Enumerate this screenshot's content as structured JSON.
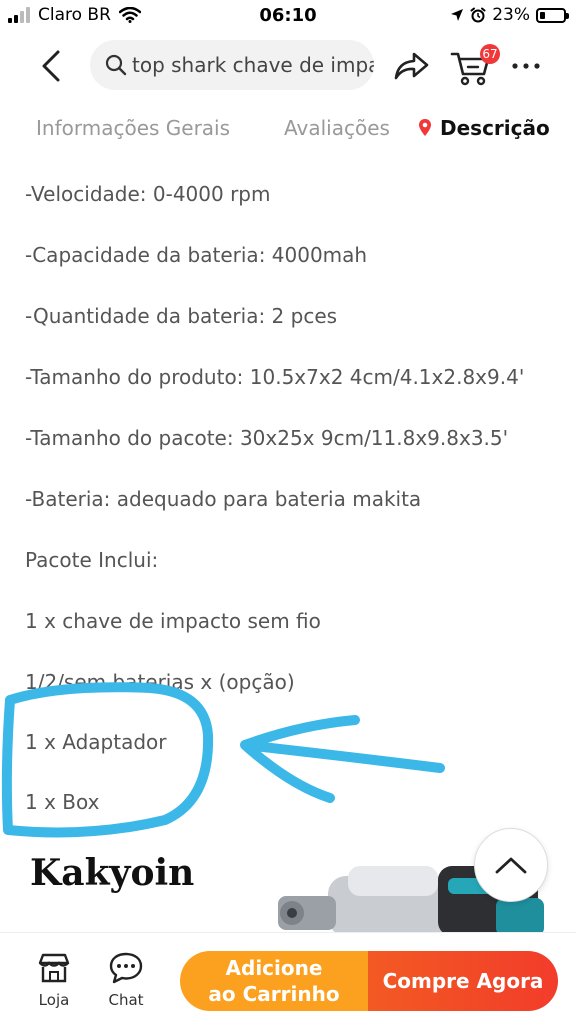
{
  "status_bar": {
    "carrier": "Claro BR",
    "time": "06:10",
    "battery_percent": "23%",
    "battery_level": 0.23
  },
  "header": {
    "search_text": "top shark chave de impa",
    "cart_badge": "67",
    "icons": [
      "back-arrow-icon",
      "search-icon",
      "share-icon",
      "cart-icon",
      "more-icon"
    ]
  },
  "tabs": [
    {
      "label": "Informações Gerais",
      "active": false
    },
    {
      "label": "Avaliações",
      "active": false
    },
    {
      "label": "Descrição",
      "active": true
    }
  ],
  "description": {
    "lines": [
      "-Velocidade: 0-4000 rpm",
      "-Capacidade da bateria: 4000mah",
      "-Quantidade da bateria: 2 pces",
      "-Tamanho do produto: 10.5x7x2 4cm/4.1x2.8x9.4'",
      "-Tamanho do pacote: 30x25x 9cm/11.8x9.8x3.5'",
      "-Bateria: adequado para bateria makita",
      "Pacote Inclui:",
      "1 x chave de impacto sem fio",
      "1/2/sem baterias x (opção)",
      "1 x Adaptador",
      "1 x Box"
    ]
  },
  "brand": {
    "title": "Kakyoin"
  },
  "bottom_bar": {
    "store_label": "Loja",
    "chat_label": "Chat",
    "add_to_cart_line1": "Adicione",
    "add_to_cart_line2": "ao Carrinho",
    "buy_now_label": "Compre Agora"
  },
  "colors": {
    "accent_red": "#f0383a",
    "add_cart_orange": "#fca01f",
    "buy_now_red": "#f23c2a",
    "annotation_blue": "#3bb8e8"
  }
}
